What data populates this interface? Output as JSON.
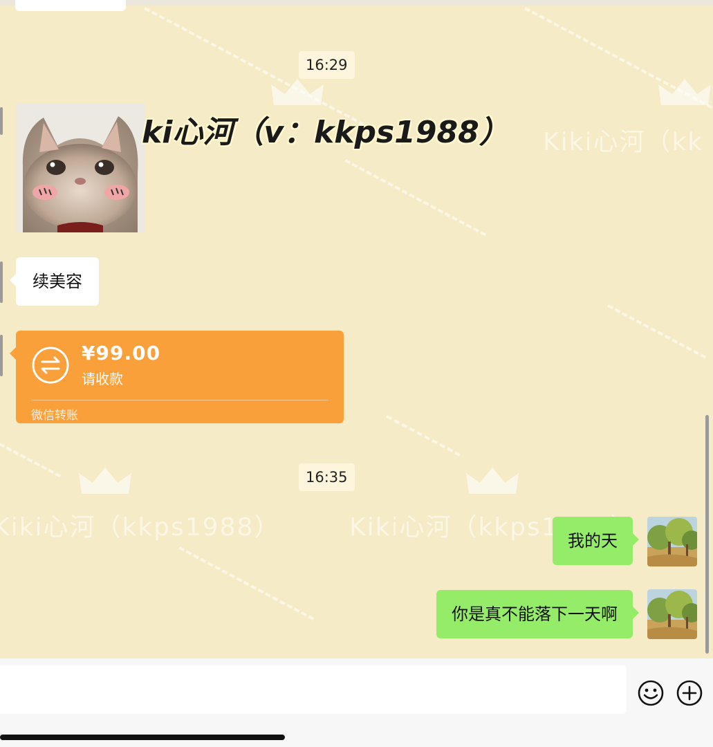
{
  "chat": {
    "timestamps": [
      "16:29",
      "16:35"
    ],
    "watermark_texts": [
      "Kiki心河（kkps1988）",
      "Kiki心河（kkps1988）",
      "Kiki心河（kk"
    ],
    "overlay_text": "ki心河（v：kkps1988）",
    "messages": {
      "text_left": "续美容",
      "transfer": {
        "amount": "¥99.00",
        "status": "请收款",
        "label": "微信转账",
        "icon": "transfer-arrows-icon",
        "color": "#f9a03b"
      },
      "sent_1": "我的天",
      "sent_2": "你是真不能落下一天啊"
    },
    "sticker": "crying-cat-sticker",
    "colors": {
      "background": "#f5ebc6",
      "sent_bubble": "#95ec69",
      "received_bubble": "#ffffff"
    }
  },
  "input_bar": {
    "message_value": "",
    "emoji_icon": "smiley-icon",
    "plus_icon": "plus-circle-icon"
  }
}
